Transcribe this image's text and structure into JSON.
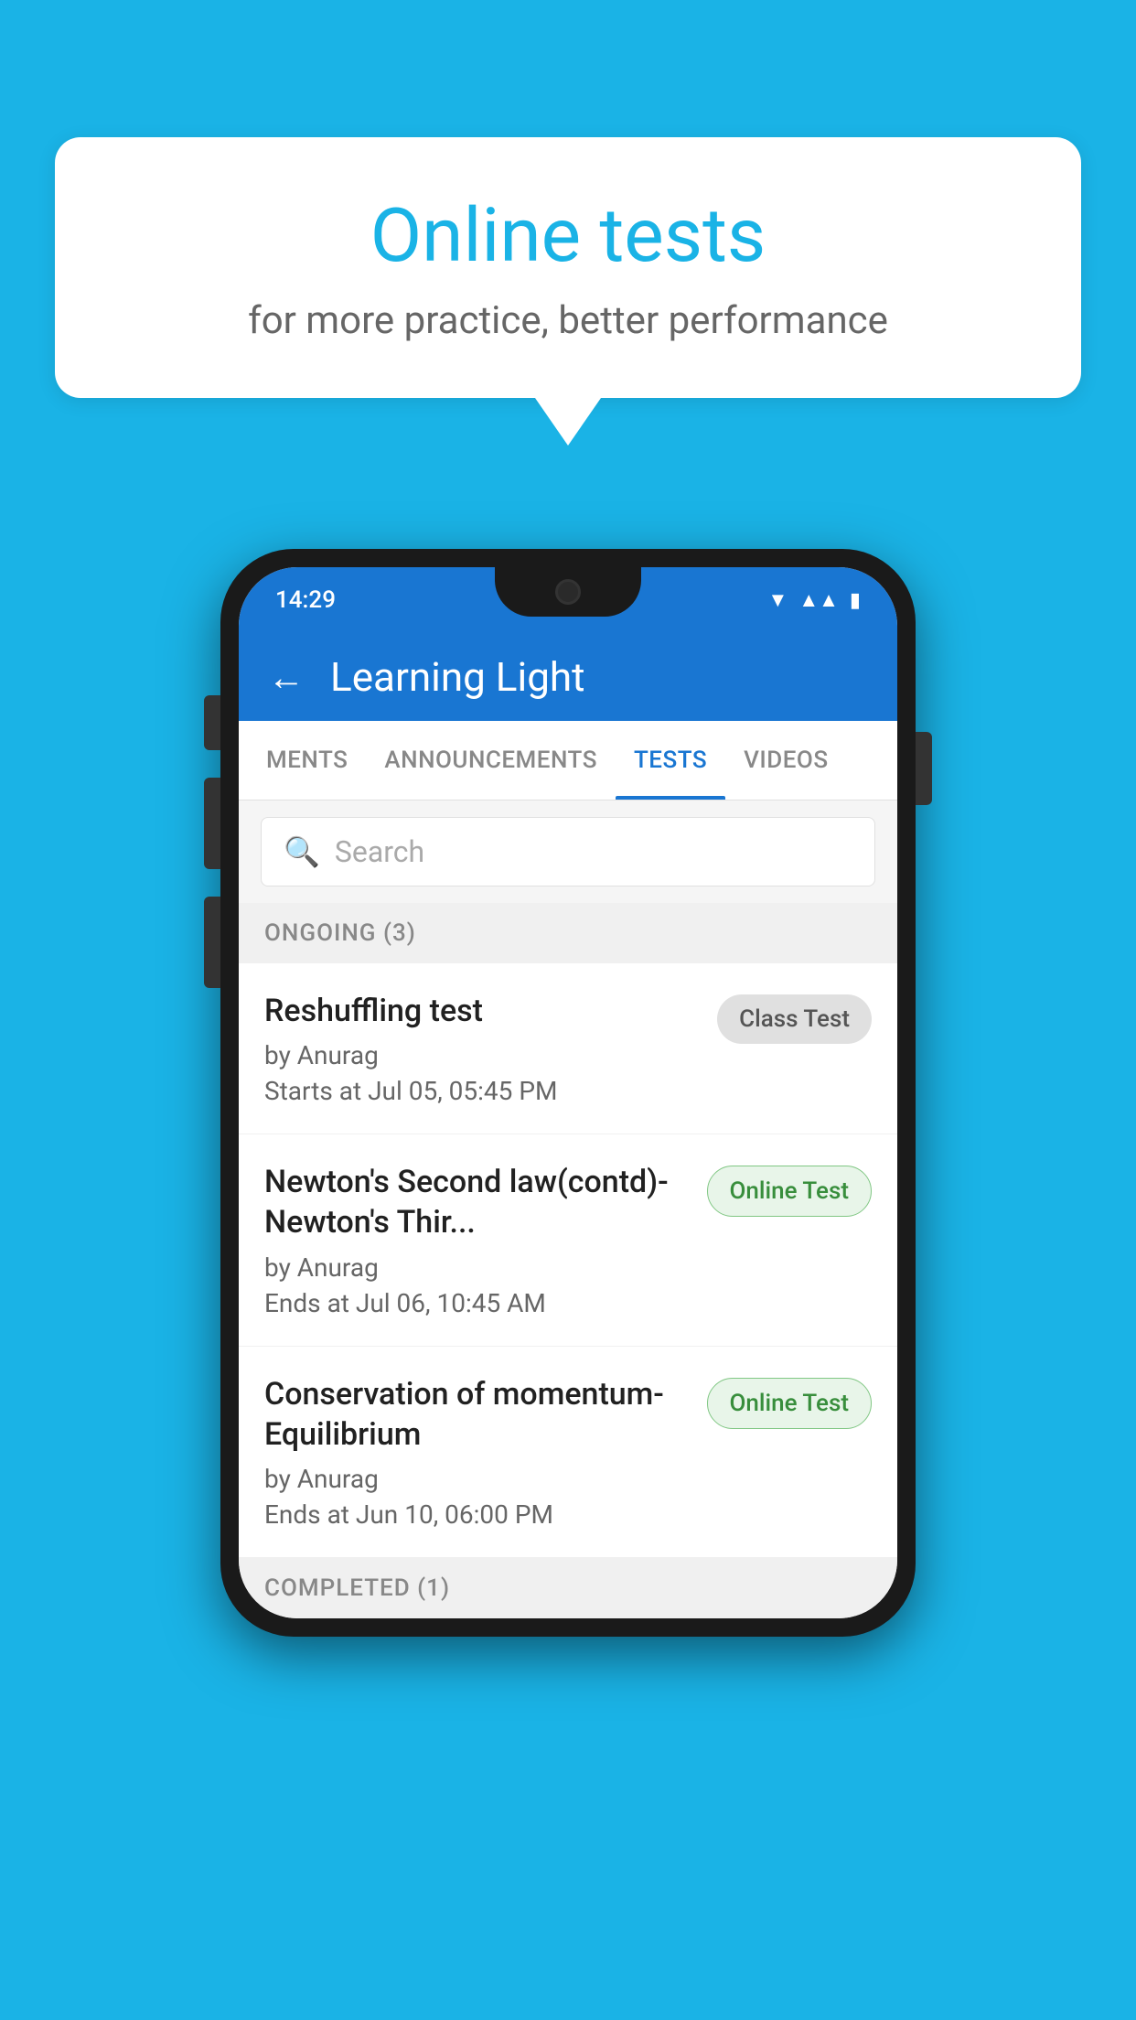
{
  "background_color": "#1ab3e6",
  "speech_bubble": {
    "title": "Online tests",
    "subtitle": "for more practice, better performance"
  },
  "phone": {
    "status_bar": {
      "time": "14:29",
      "icons": [
        "wifi",
        "signal",
        "battery"
      ]
    },
    "header": {
      "title": "Learning Light",
      "back_label": "←"
    },
    "tabs": [
      {
        "label": "MENTS",
        "active": false
      },
      {
        "label": "ANNOUNCEMENTS",
        "active": false
      },
      {
        "label": "TESTS",
        "active": true
      },
      {
        "label": "VIDEOS",
        "active": false
      }
    ],
    "search": {
      "placeholder": "Search"
    },
    "sections": [
      {
        "label": "ONGOING (3)",
        "items": [
          {
            "name": "Reshuffling test",
            "author": "by Anurag",
            "time_label": "Starts at",
            "time": "Jul 05, 05:45 PM",
            "badge": "Class Test",
            "badge_type": "class"
          },
          {
            "name": "Newton's Second law(contd)-Newton's Thir...",
            "author": "by Anurag",
            "time_label": "Ends at",
            "time": "Jul 06, 10:45 AM",
            "badge": "Online Test",
            "badge_type": "online"
          },
          {
            "name": "Conservation of momentum-Equilibrium",
            "author": "by Anurag",
            "time_label": "Ends at",
            "time": "Jun 10, 06:00 PM",
            "badge": "Online Test",
            "badge_type": "online"
          }
        ]
      }
    ],
    "completed_section_label": "COMPLETED (1)"
  }
}
